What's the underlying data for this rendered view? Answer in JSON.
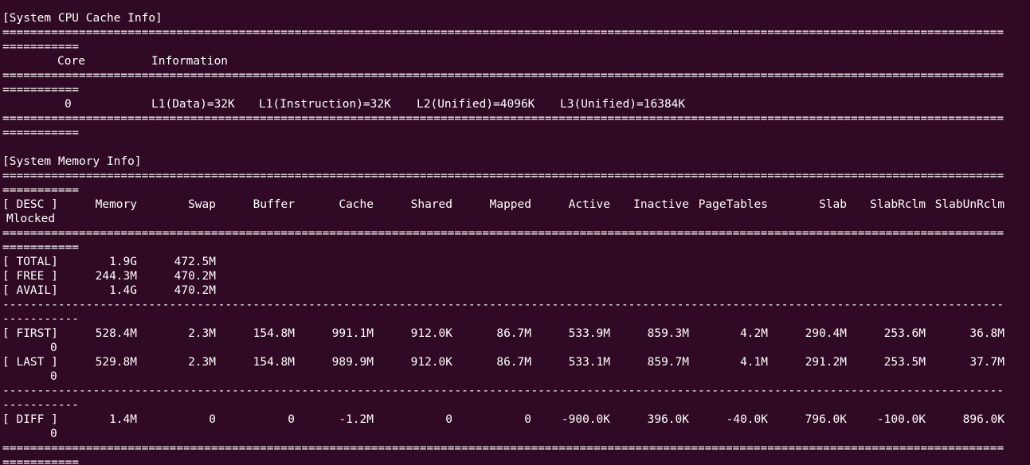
{
  "terminal": {
    "cpu_section_title": "[System CPU Cache Info]",
    "mem_section_title": "[System Memory Info]",
    "sep_full_eq": "================================================================================================================================================",
    "sep_wrap_eq": "===========",
    "sep_full_dash": "------------------------------------------------------------------------------------------------------------------------------------------------",
    "sep_wrap_dash": "-----------",
    "cpu_table": {
      "headers": [
        "Core",
        "Information"
      ],
      "rows": [
        {
          "core": "0",
          "l1_data": "L1(Data)=32K",
          "l1_instruction": "L1(Instruction)=32K",
          "l2_unified": "L2(Unified)=4096K",
          "l3_unified": "L3(Unified)=16384K"
        }
      ]
    },
    "mem_table": {
      "headers": [
        "[ DESC ]",
        "Memory",
        "Swap",
        "Buffer",
        "Cache",
        "Shared",
        "Mapped",
        "Active",
        "Inactive",
        "PageTables",
        "Slab",
        "SlabRclm",
        "SlabUnRclm"
      ],
      "header_wrap": "Mlocked",
      "summary_rows": [
        {
          "desc": "[ TOTAL]",
          "memory": "1.9G",
          "swap": "472.5M"
        },
        {
          "desc": "[ FREE ]",
          "memory": "244.3M",
          "swap": "470.2M"
        },
        {
          "desc": "[ AVAIL]",
          "memory": "1.4G",
          "swap": "470.2M"
        }
      ],
      "first": {
        "desc": "[ FIRST]",
        "values": [
          "528.4M",
          "2.3M",
          "154.8M",
          "991.1M",
          "912.0K",
          "86.7M",
          "533.9M",
          "859.3M",
          "4.2M",
          "290.4M",
          "253.6M",
          "36.8M"
        ],
        "mlocked": "0"
      },
      "last": {
        "desc": "[ LAST ]",
        "values": [
          "529.8M",
          "2.3M",
          "154.8M",
          "989.9M",
          "912.0K",
          "86.7M",
          "533.1M",
          "859.7M",
          "4.1M",
          "291.2M",
          "253.5M",
          "37.7M"
        ],
        "mlocked": "0"
      },
      "diff": {
        "desc": "[ DIFF ]",
        "values": [
          "1.4M",
          "0",
          "0",
          "-1.2M",
          "0",
          "0",
          "-900.0K",
          "396.0K",
          "-40.0K",
          "796.0K",
          "-100.0K",
          "896.0K"
        ],
        "mlocked": "0"
      }
    }
  }
}
